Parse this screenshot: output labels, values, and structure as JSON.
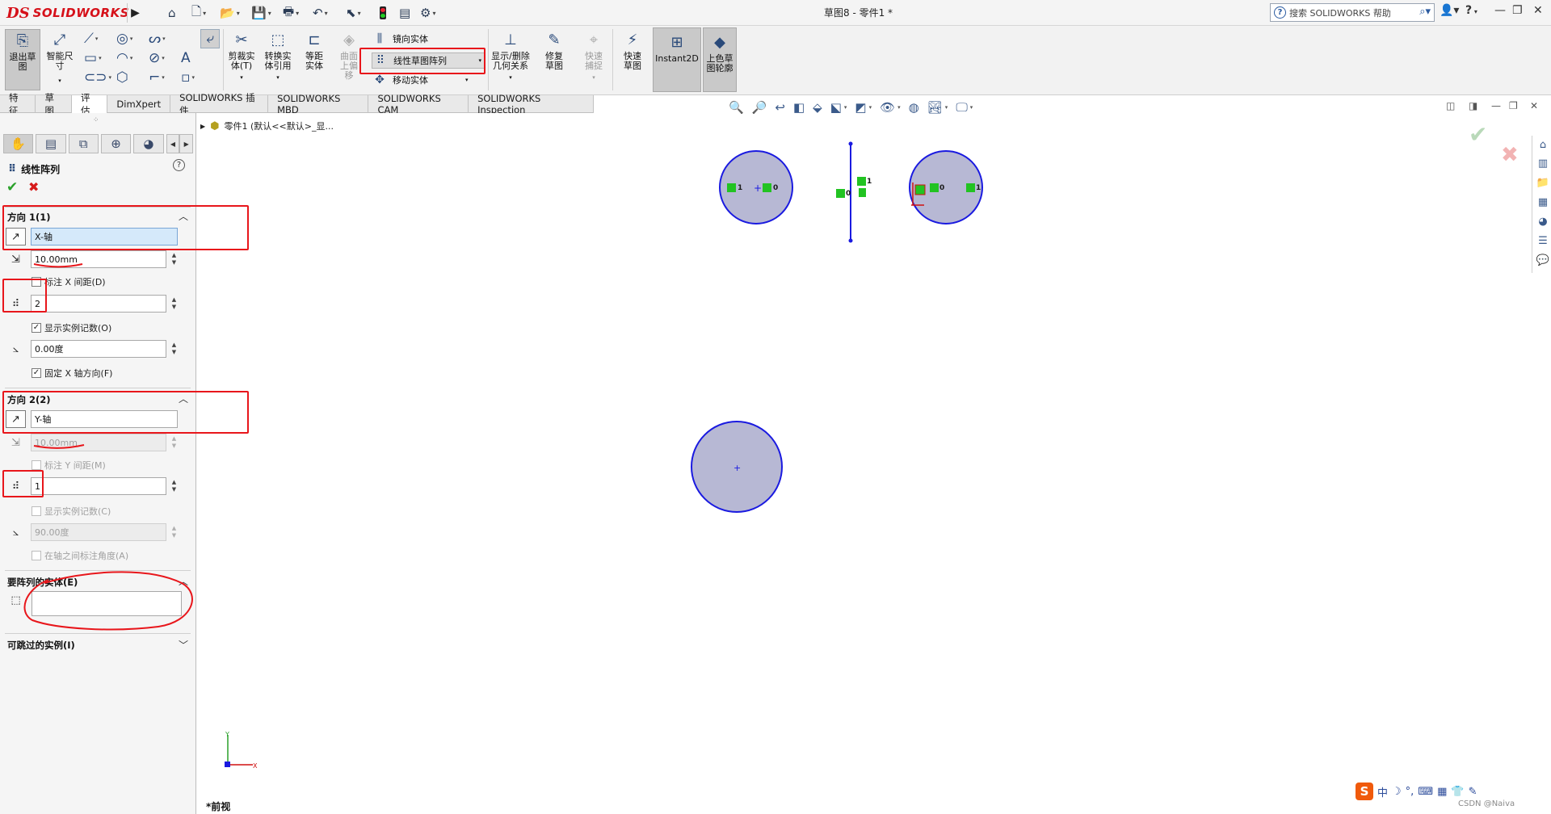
{
  "app": {
    "brand_prefix": "DS",
    "brand_name": "SOLIDWORKS",
    "document_title": "草图8 - 零件1 *",
    "search_placeholder": "搜索 SOLIDWORKS 帮助",
    "help_glyph": "?",
    "question_menu": "?"
  },
  "ribbon": {
    "exit_sketch": "退出草图",
    "smart_dimension": "智能尺寸",
    "trim_entities": "剪裁实体(T)",
    "convert_entities": "转换实体引用",
    "offset_entities": "等距实体",
    "surface_offset": "曲面上偏移",
    "mirror_entities": "镜向实体",
    "linear_pattern": "线性草图阵列",
    "move_entities": "移动实体",
    "display_relations": "显示/删除几何关系",
    "repair_sketch": "修复草图",
    "quick_snaps": "快速捕捉",
    "rapid_sketch": "快速草图",
    "instant2d": "Instant2D",
    "shaded_contours": "上色草图轮廓"
  },
  "tabs": [
    "特征",
    "草图",
    "评估",
    "DimXpert",
    "SOLIDWORKS 插件",
    "SOLIDWORKS MBD",
    "SOLIDWORKS CAM",
    "SOLIDWORKS Inspection"
  ],
  "active_tab": "评估",
  "property_manager": {
    "title": "线性阵列",
    "direction1": {
      "title": "方向 1(1)",
      "axis": "X-轴",
      "spacing": "10.00mm",
      "dim_spacing_label": "标注 X 间距(D)",
      "dim_spacing_checked": false,
      "instances": "2",
      "show_count_label": "显示实例记数(O)",
      "show_count_checked": true,
      "angle": "0.00度",
      "fix_axis_label": "固定 X 轴方向(F)",
      "fix_axis_checked": true
    },
    "direction2": {
      "title": "方向 2(2)",
      "axis": "Y-轴",
      "spacing": "10.00mm",
      "dim_spacing_label": "标注 Y 间距(M)",
      "dim_spacing_checked": false,
      "instances": "1",
      "show_count_label": "显示实例记数(C)",
      "show_count_checked": false,
      "angle": "90.00度",
      "dim_angle_label": "在轴之间标注角度(A)",
      "dim_angle_checked": false
    },
    "entities_title": "要阵列的实体(E)",
    "skip_title": "可跳过的实例(I)"
  },
  "tree": {
    "item": "零件1  (默认<<默认>_显..."
  },
  "canvas": {
    "view_label": "*前视",
    "relation_labels": [
      "1",
      "0",
      "0",
      "1",
      "0",
      "1"
    ]
  },
  "watermark": "CSDN @Naiva",
  "ime": {
    "logo": "S",
    "mode": "中"
  },
  "colors": {
    "brand_red": "#d6111a",
    "highlight_red": "#e8161b",
    "sketch_blue": "#1a1ae0",
    "circle_fill": "#b7b8d4",
    "relation_green": "#22c322"
  }
}
